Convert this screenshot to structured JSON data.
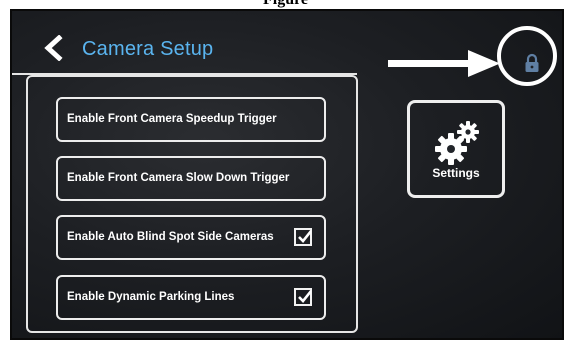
{
  "caption": "Figure",
  "header": {
    "title": "Camera Setup",
    "back_icon": "chevron-left-icon"
  },
  "options": [
    {
      "label": "Enable Front Camera Speedup Trigger",
      "checked": false
    },
    {
      "label": "Enable Front Camera Slow Down Trigger",
      "checked": false
    },
    {
      "label": "Enable Auto Blind Spot Side Cameras",
      "checked": true
    },
    {
      "label": "Enable Dynamic Parking Lines",
      "checked": true
    }
  ],
  "settings": {
    "label": "Settings",
    "icon": "gears-icon"
  },
  "lock": {
    "icon": "lock-icon"
  },
  "annotation": {
    "icon": "arrow-right-icon",
    "highlight": "circle-callout"
  },
  "colors": {
    "title": "#5ab4ef",
    "lock": "#5f7fa3",
    "screen_bg": "#1d1f23",
    "outline": "#e6e6e6"
  }
}
